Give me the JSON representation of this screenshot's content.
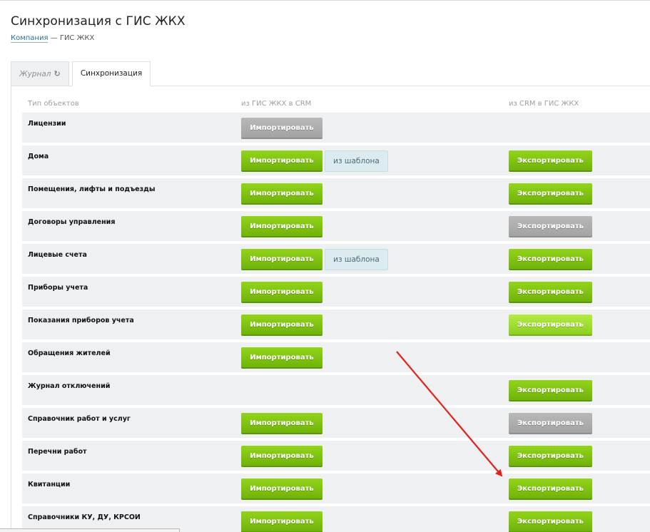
{
  "page": {
    "title": "Синхронизация с ГИС ЖКХ",
    "breadcrumb": {
      "link": "Компания",
      "separator": " — ",
      "current": "ГИС ЖКХ"
    }
  },
  "tabs": [
    {
      "label": "Журнал",
      "icon": "refresh-icon",
      "icon_glyph": "↻",
      "active": false
    },
    {
      "label": "Синхронизация",
      "active": true
    }
  ],
  "table": {
    "headers": {
      "type": "Тип объектов",
      "import": "из ГИС ЖКХ в CRM",
      "export": "из CRM в ГИС ЖКХ"
    },
    "import_label": "Импортировать",
    "export_label": "Экспортировать",
    "template_label": "из шаблона",
    "rows": [
      {
        "label": "Лицензии",
        "import": "gray",
        "template": false,
        "export": "none"
      },
      {
        "label": "Дома",
        "import": "green",
        "template": true,
        "export": "green"
      },
      {
        "label": "Помещения, лифты и подъезды",
        "import": "green",
        "template": false,
        "export": "green"
      },
      {
        "label": "Договоры управления",
        "import": "green",
        "template": false,
        "export": "gray"
      },
      {
        "label": "Лицевые счета",
        "import": "green",
        "template": true,
        "export": "green"
      },
      {
        "label": "Приборы учета",
        "import": "green",
        "template": false,
        "export": "green"
      },
      {
        "label": "Показания приборов учета",
        "import": "green",
        "template": false,
        "export": "light"
      },
      {
        "label": "Обращения жителей",
        "import": "green",
        "template": false,
        "export": "none"
      },
      {
        "label": "Журнал отключений",
        "import": "none",
        "template": false,
        "export": "green"
      },
      {
        "label": "Справочник работ и услуг",
        "import": "green",
        "template": false,
        "export": "gray"
      },
      {
        "label": "Перечни работ",
        "import": "green",
        "template": false,
        "export": "green"
      },
      {
        "label": "Квитанции",
        "import": "green",
        "template": false,
        "export": "green"
      },
      {
        "label": "Справочники КУ, ДУ, КРСОИ",
        "import": "green",
        "template": false,
        "export": "green"
      }
    ]
  },
  "colors": {
    "green": "#7ec411",
    "gray": "#aaaaaa",
    "annotation_arrow": "#e0221b"
  }
}
